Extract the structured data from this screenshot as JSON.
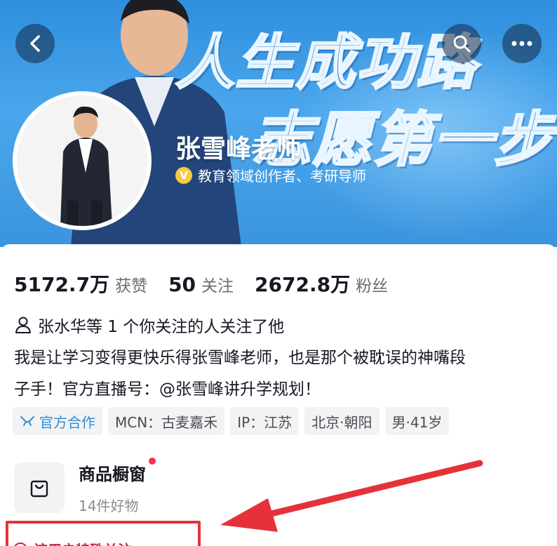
{
  "banner": {
    "slogan_line1": "人生成功路",
    "slogan_line2": "志愿第一步"
  },
  "profile": {
    "name": "张雪峰老师",
    "verify_badge": "V",
    "verified_text": "教育领域创作者、考研导师"
  },
  "stats": [
    {
      "num": "5172.7万",
      "label": "获赞"
    },
    {
      "num": "50",
      "label": "关注"
    },
    {
      "num": "2672.8万",
      "label": "粉丝"
    }
  ],
  "mutual": {
    "text": "张水华等 1 个你关注的人关注了他"
  },
  "bio": {
    "line1": "我是让学习变得更快乐得张雪峰老师，也是那个被耽误的神嘴段",
    "line2": "子手！官方直播号：@张雪峰讲升学规划！"
  },
  "tags": [
    {
      "label": "官方合作"
    },
    {
      "label": "MCN：古麦嘉禾"
    },
    {
      "label": "IP：江苏"
    },
    {
      "label": "北京·朝阳"
    },
    {
      "label": "男·41岁"
    }
  ],
  "shop": {
    "title": "商品橱窗",
    "subtitle": "14件好物"
  },
  "highlight": {
    "text": "该用户特殊关注"
  },
  "colors": {
    "banner_blue": "#3b95de",
    "accent_red": "#fe2c55",
    "annotation_red": "#e5323a",
    "official_blue": "#2f8fd8"
  },
  "icons": [
    "back-icon",
    "search-icon",
    "more-icon",
    "person-icon",
    "official-cooperation-icon",
    "shopping-bag-icon",
    "annotation-arrow"
  ]
}
